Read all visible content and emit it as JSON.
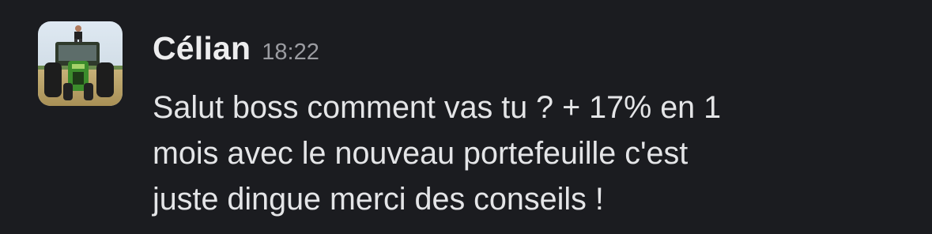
{
  "message": {
    "author": "Célian",
    "time": "18:22",
    "avatar_icon": "profile-photo-tractor",
    "lines": [
      "Salut boss comment vas tu ? + 17% en 1",
      "mois avec le nouveau portefeuille c'est",
      "juste dingue merci des conseils !"
    ]
  },
  "colors": {
    "background": "#1b1c20",
    "author": "#ededee",
    "timestamp": "#9b9ca1",
    "text": "#e4e5e7"
  }
}
